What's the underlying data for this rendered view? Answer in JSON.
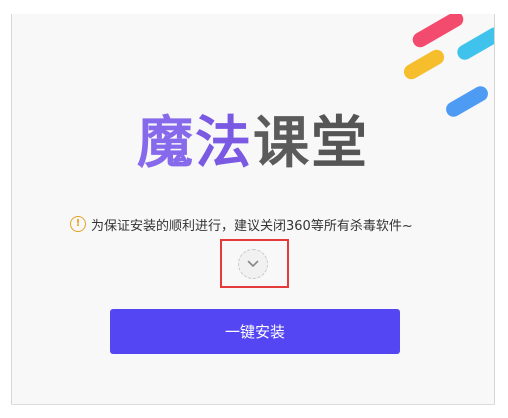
{
  "logo": {
    "chars": [
      "魔",
      "法",
      "课",
      "堂"
    ]
  },
  "notice": {
    "icon": "warning-icon",
    "icon_glyph": "!",
    "icon_color": "#e7a224",
    "text": "为保证安装的顺利进行，建议关闭360等所有杀毒软件~"
  },
  "expand": {
    "icon": "chevron-down-icon"
  },
  "install_button": {
    "label": "一键安装",
    "color": "#5446f2"
  },
  "decoration": {
    "colors": [
      "#f24b6d",
      "#3fc2ec",
      "#f6be2c",
      "#4e9bf4"
    ]
  }
}
